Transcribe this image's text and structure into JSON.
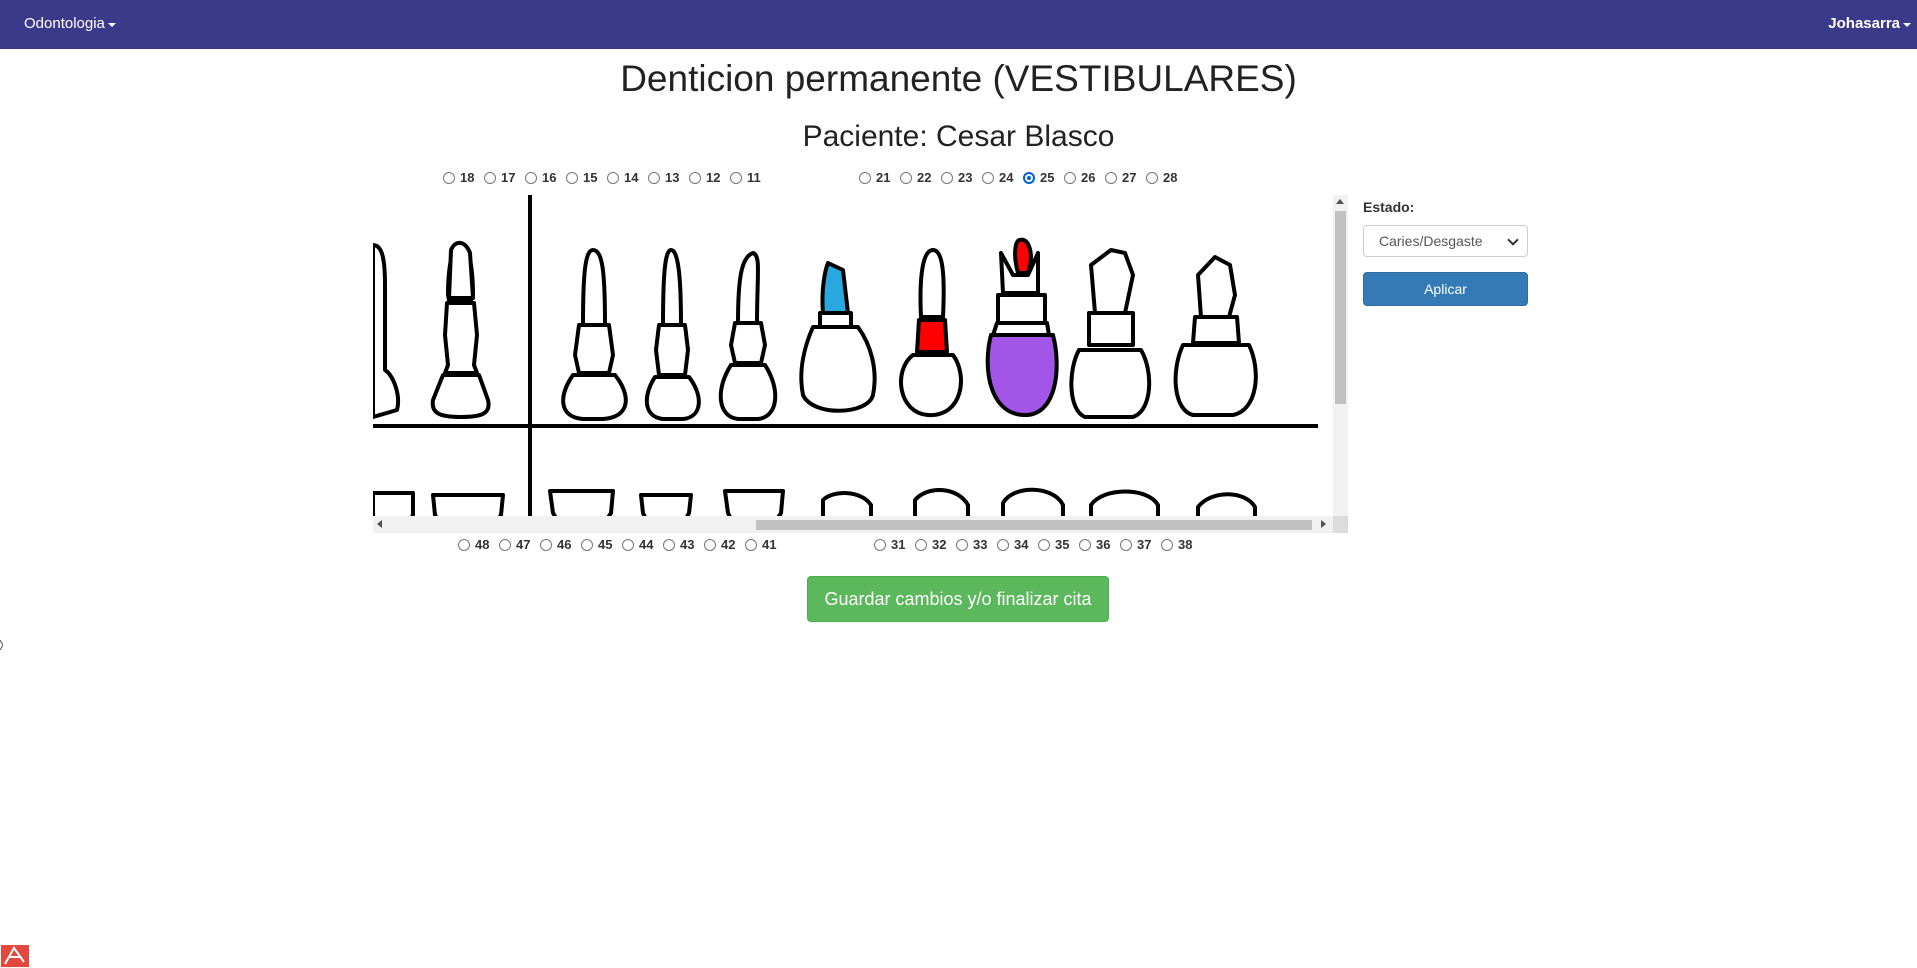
{
  "navbar": {
    "left_menu": "Odontologia",
    "right_menu": "Johasarra",
    "background": "#3b3a8a"
  },
  "page": {
    "title": "Denticion permanente (VESTIBULARES)",
    "patient": "Paciente: Cesar Blasco"
  },
  "upper_teeth_right": [
    "18",
    "17",
    "16",
    "15",
    "14",
    "13",
    "12",
    "11"
  ],
  "upper_teeth_left": [
    "21",
    "22",
    "23",
    "24",
    "25",
    "26",
    "27",
    "28"
  ],
  "lower_teeth_right": [
    "48",
    "47",
    "46",
    "45",
    "44",
    "43",
    "42",
    "41"
  ],
  "lower_teeth_left": [
    "31",
    "32",
    "33",
    "34",
    "35",
    "36",
    "37",
    "38"
  ],
  "selected_tooth": "25",
  "side_panel": {
    "estado_label": "Estado:",
    "estado_value": "Caries/Desgaste",
    "apply_label": "Aplicar",
    "apply_color": "#337ab7"
  },
  "save_button": {
    "label": "Guardar cambios y/o finalizar cita",
    "color": "#5cb85c"
  },
  "odontogram": {
    "status_colors": {
      "caries": "#ff0000",
      "restoration": "#29a8e0",
      "other": "#a355e8"
    }
  }
}
